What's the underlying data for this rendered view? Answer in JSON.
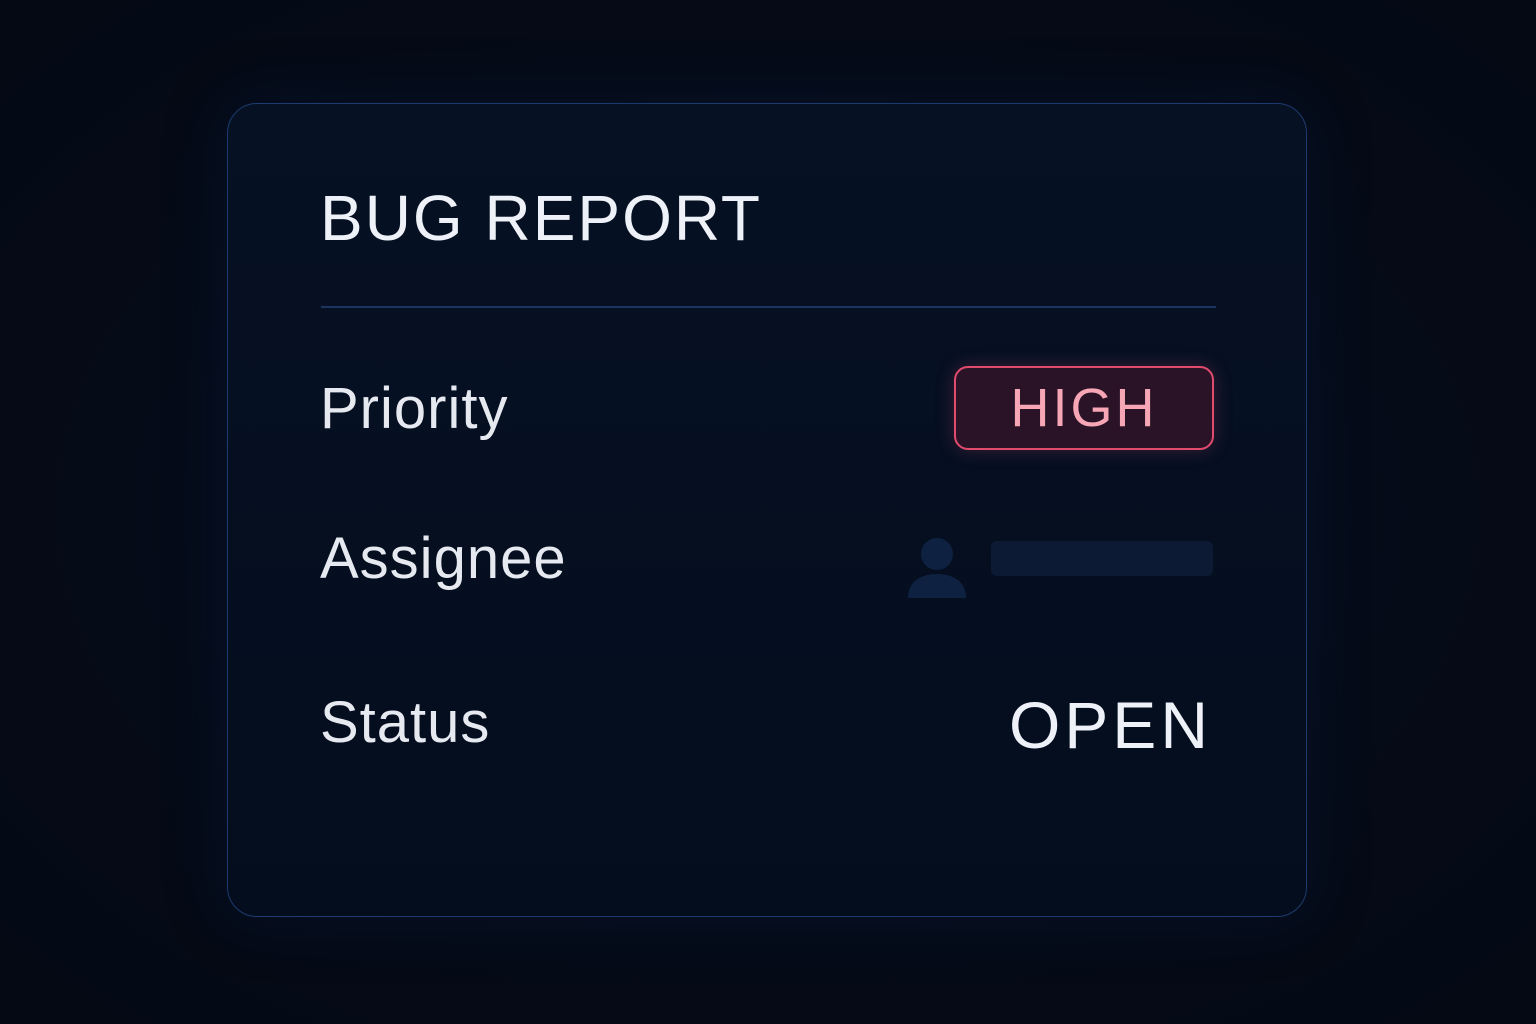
{
  "card": {
    "title": "BUG REPORT",
    "fields": {
      "priority": {
        "label": "Priority",
        "value": "HIGH"
      },
      "assignee": {
        "label": "Assignee",
        "value": ""
      },
      "status": {
        "label": "Status",
        "value": "OPEN"
      }
    }
  },
  "colors": {
    "background": "#050b17",
    "card_border": "#1d3b6e",
    "priority_high_border": "#e14b6e",
    "priority_high_text": "#f7a6b6",
    "priority_high_fill": "#2a1326",
    "placeholder": "#0c1b33"
  },
  "icons": {
    "assignee_avatar": "user-icon"
  }
}
